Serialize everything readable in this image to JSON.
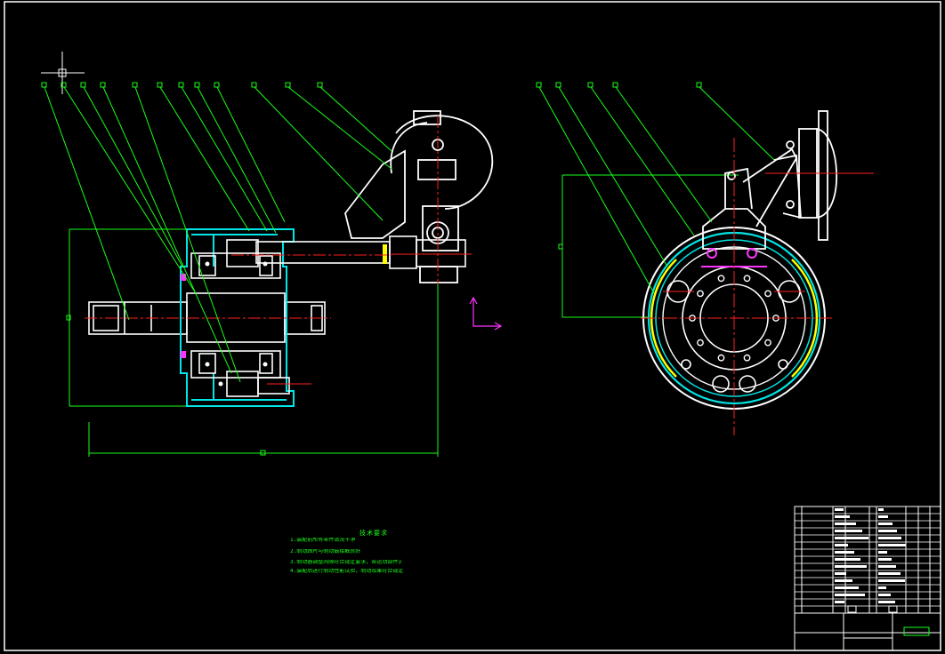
{
  "drawing": {
    "colors": {
      "background": "#000000",
      "outline": "#ffffff",
      "leader": "#19ff19",
      "centerline": "#ff1e1e",
      "housing": "#00e5e5",
      "highlight": "#ffff00",
      "accent": "#ff33ff"
    },
    "left_view_balloons": 12,
    "right_view_balloons": 5,
    "notes": {
      "title": "技术要求",
      "lines": [
        "1.装配前所有零件清洗干净",
        "2.制动蹄片与制动鼓接触良好",
        "3.制动器调整间隙符合规定要求，各运动部件灵活可靠",
        "4.装配后进行制动性能试验，制动效果符合规定"
      ]
    }
  }
}
